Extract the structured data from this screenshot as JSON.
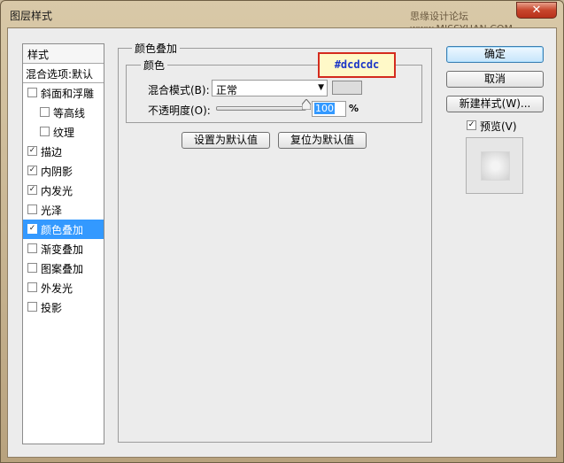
{
  "window": {
    "title": "图层样式",
    "watermark": "思缘设计论坛 www.MISSYUAN.COM",
    "close_glyph": "✕"
  },
  "styles_panel": {
    "header": "样式",
    "blend_options": "混合选项:默认",
    "items": [
      {
        "label": "斜面和浮雕",
        "checked": false,
        "indent": 0,
        "selected": false
      },
      {
        "label": "等高线",
        "checked": false,
        "indent": 1,
        "selected": false
      },
      {
        "label": "纹理",
        "checked": false,
        "indent": 1,
        "selected": false
      },
      {
        "label": "描边",
        "checked": true,
        "indent": 0,
        "selected": false
      },
      {
        "label": "内阴影",
        "checked": true,
        "indent": 0,
        "selected": false
      },
      {
        "label": "内发光",
        "checked": true,
        "indent": 0,
        "selected": false
      },
      {
        "label": "光泽",
        "checked": false,
        "indent": 0,
        "selected": false
      },
      {
        "label": "颜色叠加",
        "checked": true,
        "indent": 0,
        "selected": true
      },
      {
        "label": "渐变叠加",
        "checked": false,
        "indent": 0,
        "selected": false
      },
      {
        "label": "图案叠加",
        "checked": false,
        "indent": 0,
        "selected": false
      },
      {
        "label": "外发光",
        "checked": false,
        "indent": 0,
        "selected": false
      },
      {
        "label": "投影",
        "checked": false,
        "indent": 0,
        "selected": false
      }
    ],
    "check_glyph": "✓"
  },
  "color_overlay": {
    "group_title": "颜色叠加",
    "subgroup_title": "颜色",
    "blend_mode_label": "混合模式(B):",
    "blend_mode_value": "正常",
    "dropdown_glyph": "▼",
    "swatch_color": "#dcdcdc",
    "opacity_label": "不透明度(O):",
    "opacity_value": "100",
    "opacity_fraction": 1.0,
    "percent_sign": "%",
    "set_default_button": "设置为默认值",
    "reset_default_button": "复位为默认值"
  },
  "right_buttons": {
    "ok": "确定",
    "cancel": "取消",
    "new_style": "新建样式(W)...",
    "preview_label": "预览(V)",
    "preview_checked": true
  },
  "annotation": {
    "text": "#dcdcdc",
    "border_color": "#d42b1e",
    "text_color": "#1a35c7"
  }
}
